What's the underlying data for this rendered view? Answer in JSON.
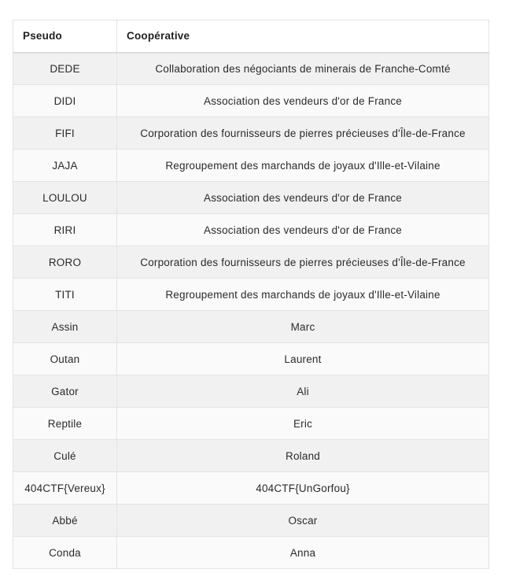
{
  "table": {
    "headers": [
      "Pseudo",
      "Coopérative"
    ],
    "rows": [
      [
        "DEDE",
        "Collaboration des négociants de minerais de Franche-Comté"
      ],
      [
        "DIDI",
        "Association des vendeurs d'or de France"
      ],
      [
        "FIFI",
        "Corporation des fournisseurs de pierres précieuses d'Île-de-France"
      ],
      [
        "JAJA",
        "Regroupement des marchands de joyaux d'Ille-et-Vilaine"
      ],
      [
        "LOULOU",
        "Association des vendeurs d'or de France"
      ],
      [
        "RIRI",
        "Association des vendeurs d'or de France"
      ],
      [
        "RORO",
        "Corporation des fournisseurs de pierres précieuses d'Île-de-France"
      ],
      [
        "TITI",
        "Regroupement des marchands de joyaux d'Ille-et-Vilaine"
      ],
      [
        "Assin",
        "Marc"
      ],
      [
        "Outan",
        "Laurent"
      ],
      [
        "Gator",
        "Ali"
      ],
      [
        "Reptile",
        "Eric"
      ],
      [
        "Culé",
        "Roland"
      ],
      [
        "404CTF{Vereux}",
        "404CTF{UnGorfou}"
      ],
      [
        "Abbé",
        "Oscar"
      ],
      [
        "Conda",
        "Anna"
      ]
    ]
  }
}
